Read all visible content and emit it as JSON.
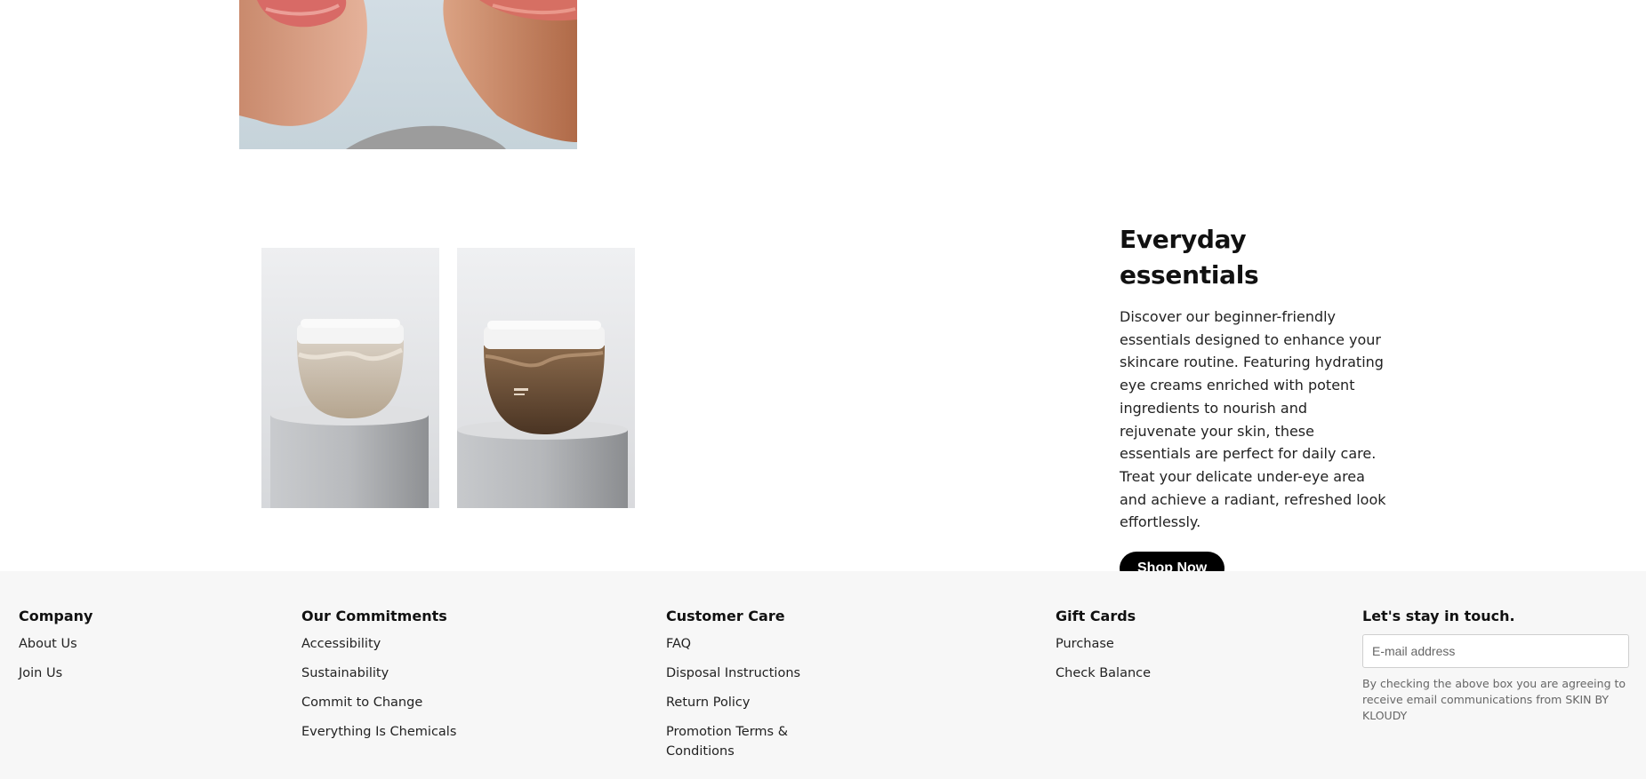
{
  "hero_image": {
    "alt_icon": "lips-closeup-image"
  },
  "products": [
    {
      "icon": "light-cream-jar-image"
    },
    {
      "icon": "dark-cream-jar-image"
    }
  ],
  "essentials": {
    "title": "Everyday essentials",
    "description": "Discover our beginner-friendly essentials designed to enhance your skincare routine. Featuring hydrating eye creams enriched with potent ingredients to nourish and rejuvenate your skin, these essentials are perfect for daily care. Treat your delicate under-eye area and achieve a radiant, refreshed look effortlessly.",
    "cta_label": "Shop Now"
  },
  "footer": {
    "company": {
      "heading": "Company",
      "links": [
        "About Us",
        "Join Us"
      ]
    },
    "commitments": {
      "heading": "Our Commitments",
      "links": [
        "Accessibility",
        "Sustainability",
        "Commit to Change",
        "Everything Is Chemicals"
      ]
    },
    "customer_care": {
      "heading": "Customer Care",
      "links": [
        "FAQ",
        "Disposal Instructions",
        "Return Policy",
        "Promotion Terms & Conditions"
      ]
    },
    "gift_cards": {
      "heading": "Gift Cards",
      "links": [
        "Purchase",
        "Check Balance"
      ]
    },
    "newsletter": {
      "heading": "Let's stay in touch.",
      "email_placeholder": "E-mail address",
      "note": "By checking the above box you are agreeing to receive email communications from SKIN BY KLOUDY"
    }
  },
  "colors": {
    "footer_bg": "#f7f7f7",
    "button_bg": "#000000",
    "button_text": "#ffffff"
  }
}
